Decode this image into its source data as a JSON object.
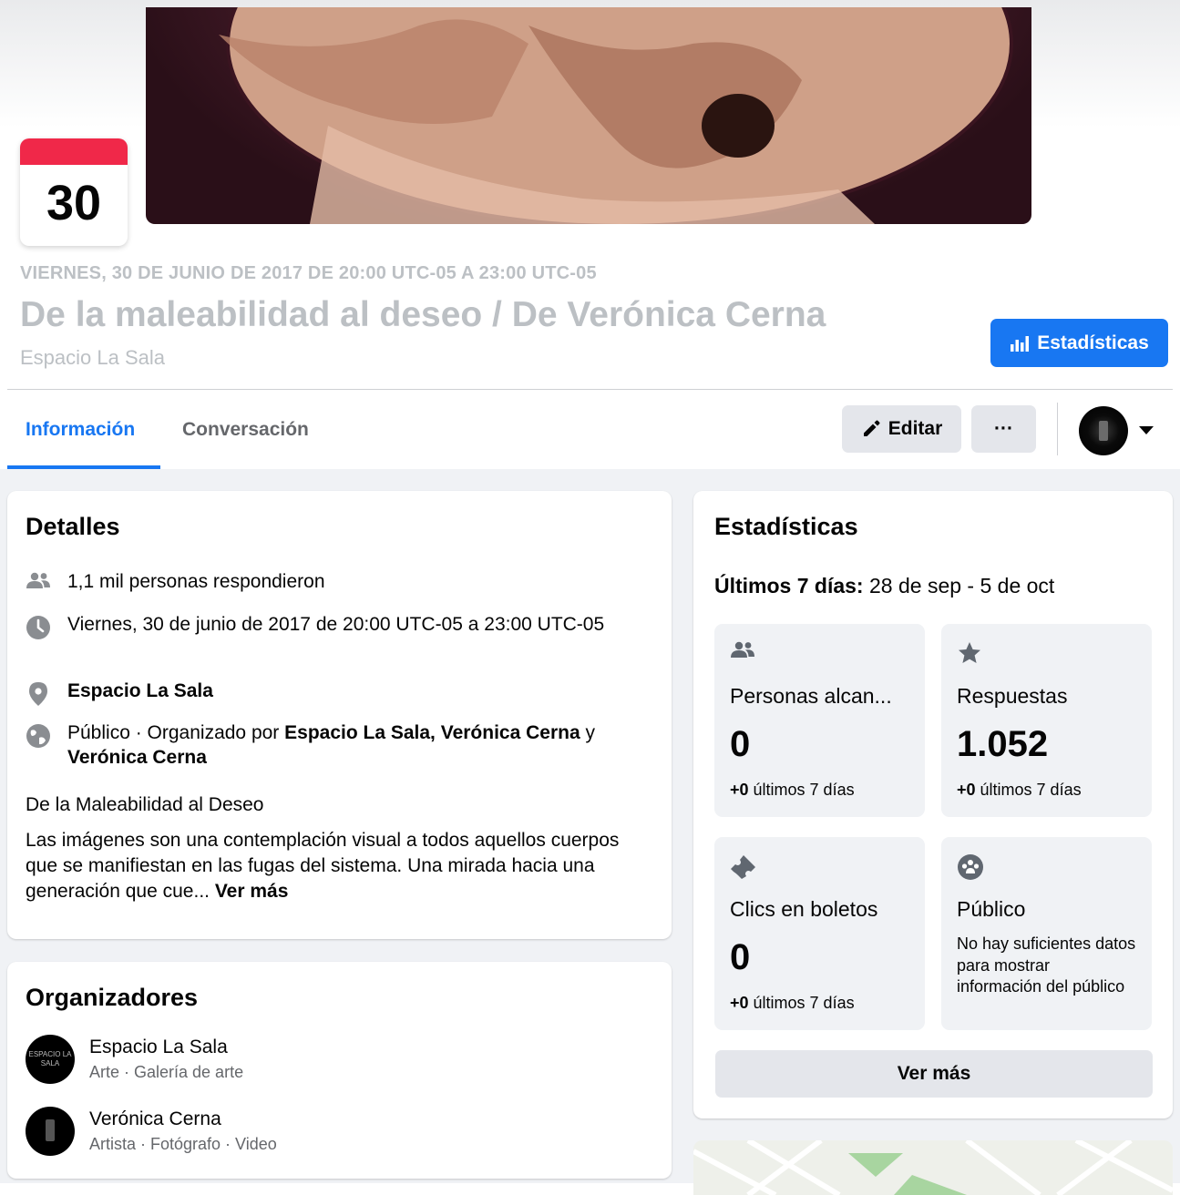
{
  "event": {
    "day": "30",
    "datetime": "VIERNES, 30 DE JUNIO DE 2017 DE 20:00 UTC-05 A 23:00 UTC-05",
    "title": "De la maleabilidad al deseo / De Verónica Cerna",
    "host": "Espacio La Sala",
    "stats_button_label": "Estadísticas"
  },
  "tabs": [
    {
      "label": "Información",
      "active": true
    },
    {
      "label": "Conversación",
      "active": false
    }
  ],
  "actions": {
    "edit_label": "Editar",
    "more_label": "···"
  },
  "details": {
    "heading": "Detalles",
    "responded": "1,1 mil personas respondieron",
    "datetime": "Viernes, 30 de junio de 2017 de 20:00 UTC-05 a 23:00 UTC-05",
    "location": "Espacio La Sala",
    "privacy_prefix": "Público · Organizado por ",
    "organizers_bold_1": "Espacio La Sala, Verónica Cerna",
    "conjunction": " y ",
    "organizers_bold_2": "Verónica Cerna",
    "subtitle": "De la Maleabilidad al Deseo",
    "description": "Las imágenes son una contemplación visual a todos aquellos cuerpos que se manifiestan en las fugas del sistema. Una mirada hacia una generación que cue... ",
    "see_more": "Ver más"
  },
  "organizers": {
    "heading": "Organizadores",
    "items": [
      {
        "name": "Espacio La Sala",
        "subtitle": "Arte · Galería de arte",
        "avatar_text": "ESPACIO LA SALA"
      },
      {
        "name": "Verónica Cerna",
        "subtitle": "Artista · Fotógrafo · Video"
      }
    ]
  },
  "stats": {
    "heading": "Estadísticas",
    "range_label": "Últimos 7 días:",
    "range_value": " 28 de sep - 5 de oct",
    "boxes": [
      {
        "icon": "people-icon",
        "label": "Personas alcan...",
        "value": "0",
        "delta_bold": "+0",
        "delta_text": " últimos 7 días"
      },
      {
        "icon": "star-icon",
        "label": "Respuestas",
        "value": "1.052",
        "delta_bold": "+0",
        "delta_text": " últimos 7 días"
      },
      {
        "icon": "ticket-icon",
        "label": "Clics en boletos",
        "value": "0",
        "delta_bold": "+0",
        "delta_text": " últimos 7 días"
      },
      {
        "icon": "audience-icon",
        "label": "Público",
        "note": "No hay suficientes datos para mostrar información del público"
      }
    ],
    "see_more": "Ver más"
  },
  "colors": {
    "accent": "#1877f2",
    "calendar_red": "#f02849",
    "muted_text": "#bcc0c4",
    "secondary_bg": "#e4e6eb",
    "page_bg": "#f0f2f5"
  }
}
